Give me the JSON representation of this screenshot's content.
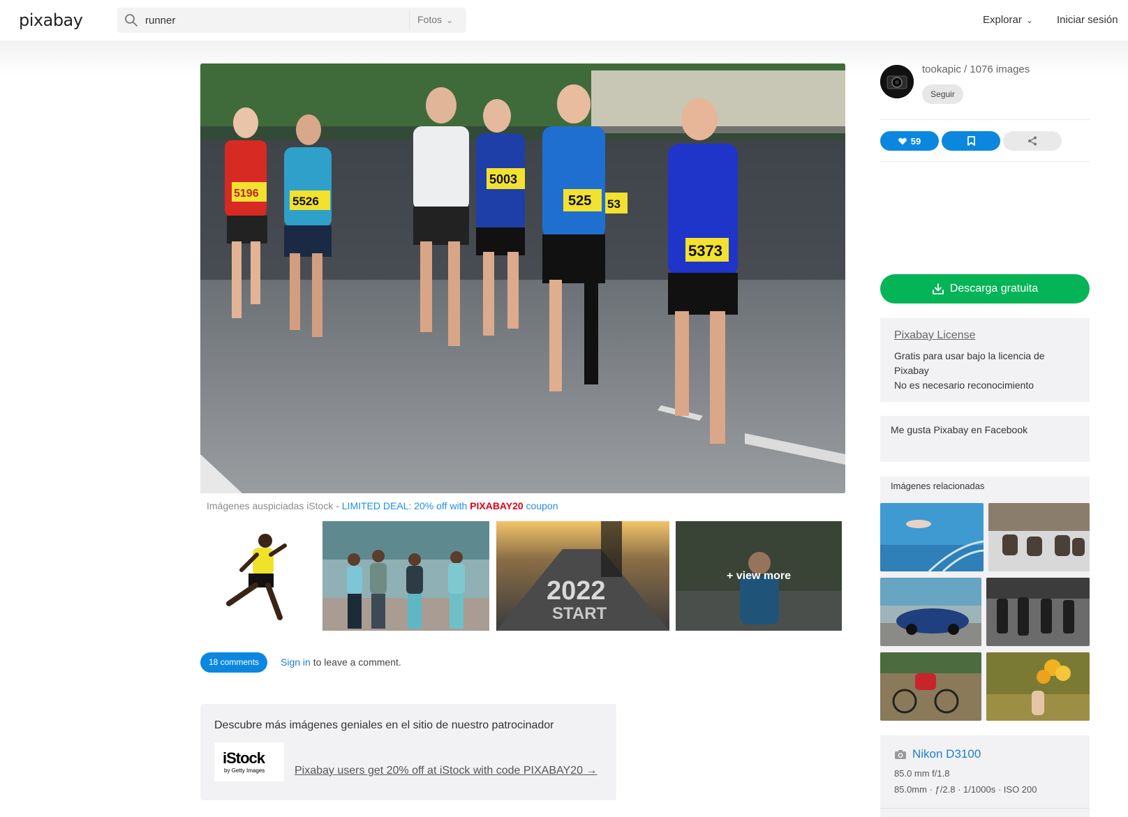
{
  "header": {
    "logo": "pixabay",
    "search": {
      "value": "runner",
      "placeholder": ""
    },
    "search_type": "Fotos",
    "explore_label": "Explorar",
    "login_label": "Iniciar sesión"
  },
  "main_image": {
    "bib_numbers": [
      "5196",
      "5526",
      "5003",
      "525",
      "5373",
      "53"
    ]
  },
  "sponsored": {
    "prefix": "Imágenes auspiciadas iStock - ",
    "deal": "LIMITED DEAL: 20% off with ",
    "code": "PIXABAY20",
    "suffix": " coupon",
    "view_more": "+ view more",
    "thumb_text": [
      "2022",
      "START"
    ]
  },
  "comments": {
    "count_label": "18 comments",
    "sign_in": "Sign in",
    "rest": " to leave a comment."
  },
  "istock": {
    "title": "Descubre más imágenes geniales en el sitio de nuestro patrocinador",
    "brand": "iStock",
    "brand_sub": "by Getty Images",
    "link": "Pixabay users get 20% off at iStock with code PIXABAY20 →"
  },
  "author": {
    "name": "tookapic / 1076 images",
    "follow_label": "Seguir"
  },
  "actions": {
    "likes": "59"
  },
  "download": {
    "label": "Descarga gratuita"
  },
  "license": {
    "title": "Pixabay License",
    "line1": "Gratis para usar bajo la licencia de Pixabay",
    "line2": "No es necesario reconocimiento"
  },
  "facebook": {
    "label": "Me gusta Pixabay en Facebook"
  },
  "related": {
    "title": "Imágenes relacionadas"
  },
  "camera": {
    "name": "Nikon D3100",
    "lens": "85.0 mm f/1.8",
    "settings": "85.0mm · ƒ/2.8 · 1/1000s · ISO 200"
  },
  "colors": {
    "accent_blue": "#0c87e0",
    "download_green": "#05b456",
    "coupon_red": "#e0001a",
    "panel_grey": "#f2f2f4"
  },
  "icons": [
    "search-icon",
    "chevron-down-icon",
    "heart-icon",
    "bookmark-icon",
    "share-icon",
    "download-icon",
    "camera-icon"
  ]
}
